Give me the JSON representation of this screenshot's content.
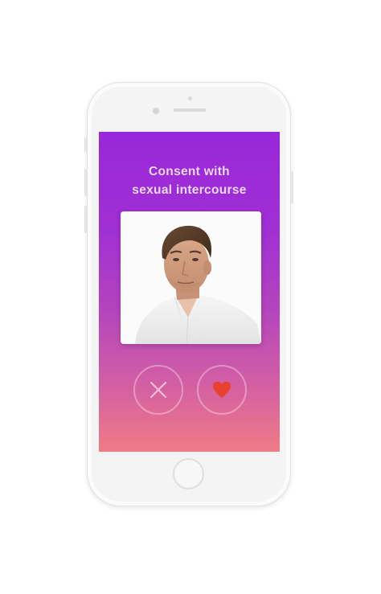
{
  "app": {
    "question_line1": "Consent with",
    "question_line2": "sexual intercourse"
  },
  "profile": {
    "photo_icon": "person-portrait"
  },
  "actions": {
    "reject_icon": "close-icon",
    "like_icon": "heart-icon"
  },
  "colors": {
    "gradient_top": "#9a27d9",
    "gradient_bottom": "#f07b86",
    "heart": "#e8412f",
    "reject_x": "#ffffff"
  }
}
